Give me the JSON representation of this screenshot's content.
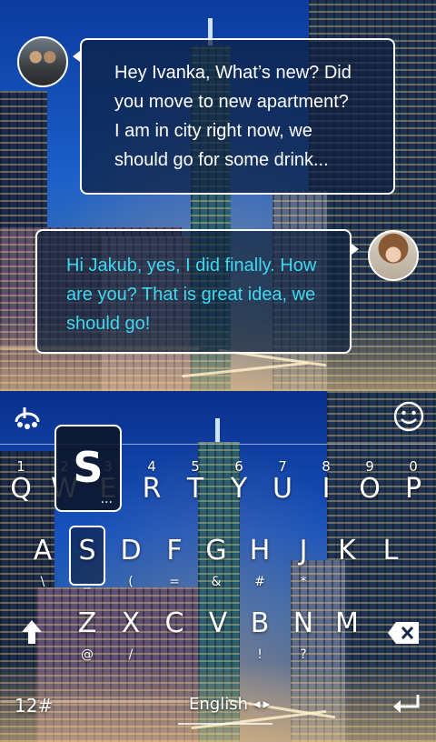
{
  "chat": {
    "incoming": {
      "lines": [
        "Hey Ivanka, What’s new? Did",
        "you move to new apartment?",
        "I am in city right now, we",
        "should go for some drink..."
      ]
    },
    "outgoing": {
      "lines": [
        "Hi Jakub, yes, I did finally. How",
        "are you? That is great idea, we",
        "should go!"
      ]
    }
  },
  "keyboard": {
    "popup_letter": "S",
    "popup_dots": "...",
    "row1": [
      {
        "key": "Q",
        "num": "1"
      },
      {
        "key": "W",
        "num": "2"
      },
      {
        "key": "E",
        "num": "3"
      },
      {
        "key": "R",
        "num": "4"
      },
      {
        "key": "T",
        "num": "5"
      },
      {
        "key": "Y",
        "num": "6"
      },
      {
        "key": "U",
        "num": "7"
      },
      {
        "key": "I",
        "num": "8"
      },
      {
        "key": "O",
        "num": "9"
      },
      {
        "key": "P",
        "num": "0"
      }
    ],
    "row2": [
      {
        "key": "A",
        "sym": "\\"
      },
      {
        "key": "S",
        "sym": "_"
      },
      {
        "key": "D",
        "sym": "("
      },
      {
        "key": "F",
        "sym": "="
      },
      {
        "key": "G",
        "sym": "&"
      },
      {
        "key": "H",
        "sym": "#"
      },
      {
        "key": "J",
        "sym": "*"
      },
      {
        "key": "K",
        "sym": ""
      },
      {
        "key": "L",
        "sym": ""
      }
    ],
    "row3": [
      {
        "key": "Z",
        "sym": "@"
      },
      {
        "key": "X",
        "sym": "/"
      },
      {
        "key": "C",
        "sym": ""
      },
      {
        "key": "V",
        "sym": ""
      },
      {
        "key": "B",
        "sym": "!"
      },
      {
        "key": "N",
        "sym": "?"
      },
      {
        "key": "M",
        "sym": ""
      }
    ],
    "symbols_label": "12#",
    "language_label": "English",
    "language_arrows": "◀ ▶"
  },
  "colors": {
    "outgoing_text": "#3fd8f0",
    "incoming_text": "#ffffff"
  }
}
